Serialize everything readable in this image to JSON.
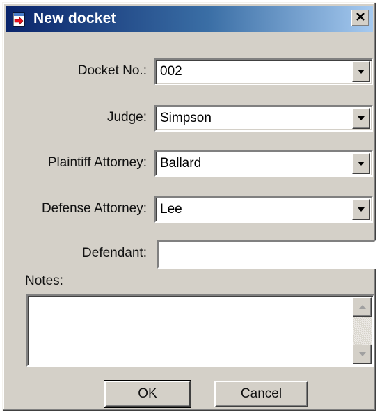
{
  "window": {
    "title": "New docket",
    "close_glyph": "✕",
    "icon": "docket-icon"
  },
  "fields": {
    "docket_no": {
      "label": "Docket No.:",
      "value": "002"
    },
    "judge": {
      "label": "Judge:",
      "value": "Simpson"
    },
    "plaintiff_attorney": {
      "label": "Plaintiff Attorney:",
      "value": "Ballard"
    },
    "defense_attorney": {
      "label": "Defense Attorney:",
      "value": "Lee"
    },
    "defendant": {
      "label": "Defendant:",
      "value": ""
    },
    "notes": {
      "label": "Notes:",
      "value": ""
    }
  },
  "buttons": {
    "ok_label": "OK",
    "cancel_label": "Cancel"
  },
  "colors": {
    "title_gradient_start": "#0a246a",
    "title_gradient_end": "#a6caf0",
    "dialog_face": "#d4d0c8"
  }
}
